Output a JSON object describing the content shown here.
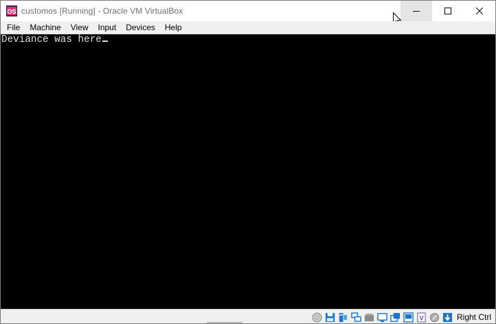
{
  "window": {
    "title": "customos [Running] - Oracle VM VirtualBox"
  },
  "menu": {
    "items": [
      "File",
      "Machine",
      "View",
      "Input",
      "Devices",
      "Help"
    ]
  },
  "guest": {
    "console_text": "Deviance was here"
  },
  "status_bar": {
    "icons": [
      "optical-drive-icon",
      "floppy-disk-icon",
      "audio-icon",
      "network-icon",
      "usb-icon",
      "shared-folders-icon",
      "display-icon",
      "video-capture-icon",
      "cpu-virtualization-icon",
      "mouse-integration-icon",
      "host-key-arrow-icon"
    ],
    "host_key_label": "Right Ctrl"
  },
  "colors": {
    "title_bg": "#ffffff",
    "menubar_bg": "#f0f0f0",
    "screen_bg": "#000000",
    "console_fg": "#dcdcdc",
    "accent_blue": "#1a73c8",
    "minimize_hover": "#e5e5e5"
  }
}
